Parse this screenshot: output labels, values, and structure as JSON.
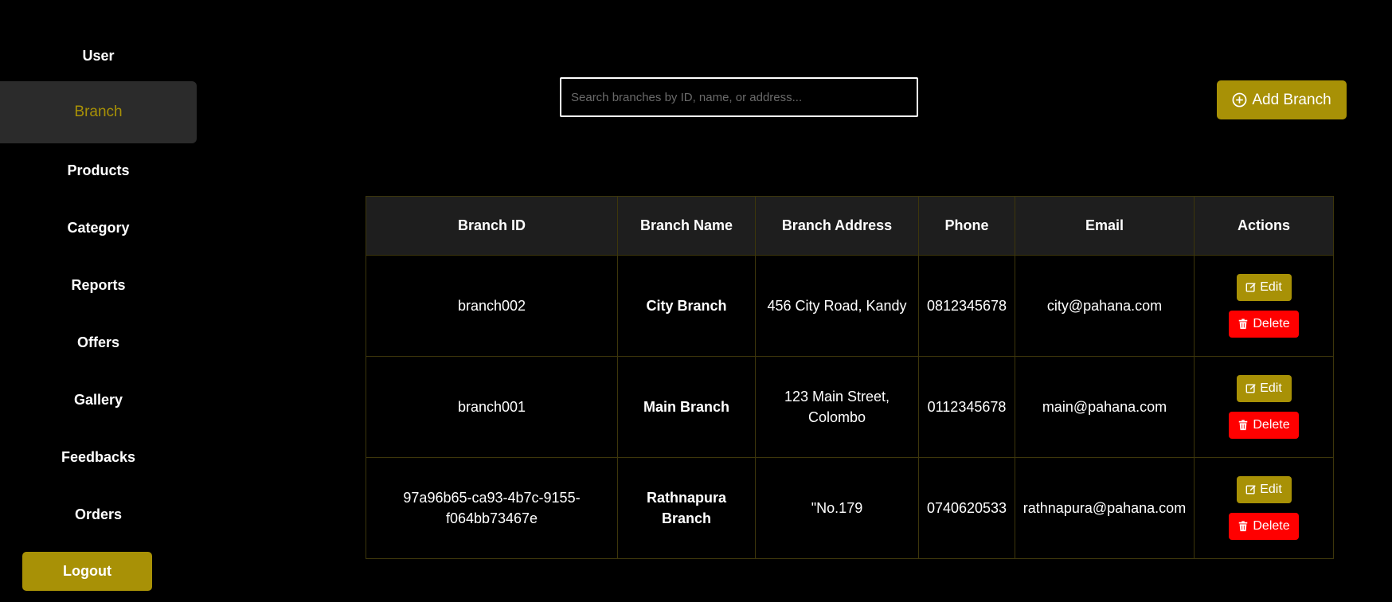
{
  "sidebar": {
    "items": [
      {
        "label": "User",
        "active": false
      },
      {
        "label": "Branch",
        "active": true
      },
      {
        "label": "Products",
        "active": false
      },
      {
        "label": "Category",
        "active": false
      },
      {
        "label": "Reports",
        "active": false
      },
      {
        "label": "Offers",
        "active": false
      },
      {
        "label": "Gallery",
        "active": false
      },
      {
        "label": "Feedbacks",
        "active": false
      },
      {
        "label": "Orders",
        "active": false
      }
    ],
    "logout_label": "Logout"
  },
  "search": {
    "placeholder": "Search branches by ID, name, or address...",
    "value": ""
  },
  "add_button": {
    "label": "Add Branch",
    "icon": "plus-circle-icon"
  },
  "table": {
    "headers": [
      "Branch ID",
      "Branch Name",
      "Branch Address",
      "Phone",
      "Email",
      "Actions"
    ],
    "rows": [
      {
        "id": "branch002",
        "name": "City Branch",
        "address": "456 City Road, Kandy",
        "phone": "0812345678",
        "email": "city@pahana.com"
      },
      {
        "id": "branch001",
        "name": "Main Branch",
        "address": "123 Main Street, Colombo",
        "phone": "0112345678",
        "email": "main@pahana.com"
      },
      {
        "id": "97a96b65-ca93-4b7c-9155-f064bb73467e",
        "name": "Rathnapura Branch",
        "address": "\"No.179",
        "phone": "0740620533",
        "email": "rathnapura@pahana.com"
      }
    ],
    "edit_label": "Edit",
    "delete_label": "Delete"
  },
  "colors": {
    "accent": "#a89106",
    "danger": "#ff0000",
    "background": "#000000",
    "header_bg": "#1e1e1e"
  }
}
